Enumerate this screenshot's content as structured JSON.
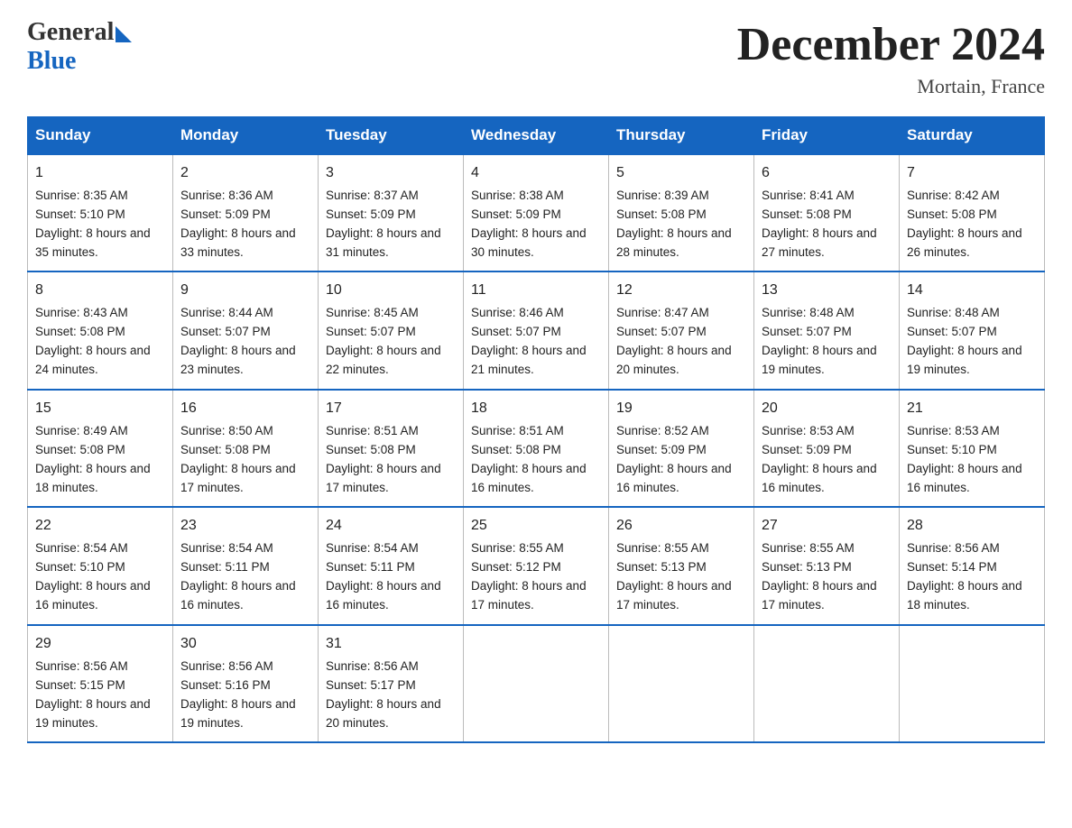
{
  "header": {
    "logo_general": "General",
    "logo_blue": "Blue",
    "title": "December 2024",
    "location": "Mortain, France"
  },
  "columns": [
    "Sunday",
    "Monday",
    "Tuesday",
    "Wednesday",
    "Thursday",
    "Friday",
    "Saturday"
  ],
  "weeks": [
    [
      {
        "day": "1",
        "sunrise": "8:35 AM",
        "sunset": "5:10 PM",
        "daylight": "8 hours and 35 minutes."
      },
      {
        "day": "2",
        "sunrise": "8:36 AM",
        "sunset": "5:09 PM",
        "daylight": "8 hours and 33 minutes."
      },
      {
        "day": "3",
        "sunrise": "8:37 AM",
        "sunset": "5:09 PM",
        "daylight": "8 hours and 31 minutes."
      },
      {
        "day": "4",
        "sunrise": "8:38 AM",
        "sunset": "5:09 PM",
        "daylight": "8 hours and 30 minutes."
      },
      {
        "day": "5",
        "sunrise": "8:39 AM",
        "sunset": "5:08 PM",
        "daylight": "8 hours and 28 minutes."
      },
      {
        "day": "6",
        "sunrise": "8:41 AM",
        "sunset": "5:08 PM",
        "daylight": "8 hours and 27 minutes."
      },
      {
        "day": "7",
        "sunrise": "8:42 AM",
        "sunset": "5:08 PM",
        "daylight": "8 hours and 26 minutes."
      }
    ],
    [
      {
        "day": "8",
        "sunrise": "8:43 AM",
        "sunset": "5:08 PM",
        "daylight": "8 hours and 24 minutes."
      },
      {
        "day": "9",
        "sunrise": "8:44 AM",
        "sunset": "5:07 PM",
        "daylight": "8 hours and 23 minutes."
      },
      {
        "day": "10",
        "sunrise": "8:45 AM",
        "sunset": "5:07 PM",
        "daylight": "8 hours and 22 minutes."
      },
      {
        "day": "11",
        "sunrise": "8:46 AM",
        "sunset": "5:07 PM",
        "daylight": "8 hours and 21 minutes."
      },
      {
        "day": "12",
        "sunrise": "8:47 AM",
        "sunset": "5:07 PM",
        "daylight": "8 hours and 20 minutes."
      },
      {
        "day": "13",
        "sunrise": "8:48 AM",
        "sunset": "5:07 PM",
        "daylight": "8 hours and 19 minutes."
      },
      {
        "day": "14",
        "sunrise": "8:48 AM",
        "sunset": "5:07 PM",
        "daylight": "8 hours and 19 minutes."
      }
    ],
    [
      {
        "day": "15",
        "sunrise": "8:49 AM",
        "sunset": "5:08 PM",
        "daylight": "8 hours and 18 minutes."
      },
      {
        "day": "16",
        "sunrise": "8:50 AM",
        "sunset": "5:08 PM",
        "daylight": "8 hours and 17 minutes."
      },
      {
        "day": "17",
        "sunrise": "8:51 AM",
        "sunset": "5:08 PM",
        "daylight": "8 hours and 17 minutes."
      },
      {
        "day": "18",
        "sunrise": "8:51 AM",
        "sunset": "5:08 PM",
        "daylight": "8 hours and 16 minutes."
      },
      {
        "day": "19",
        "sunrise": "8:52 AM",
        "sunset": "5:09 PM",
        "daylight": "8 hours and 16 minutes."
      },
      {
        "day": "20",
        "sunrise": "8:53 AM",
        "sunset": "5:09 PM",
        "daylight": "8 hours and 16 minutes."
      },
      {
        "day": "21",
        "sunrise": "8:53 AM",
        "sunset": "5:10 PM",
        "daylight": "8 hours and 16 minutes."
      }
    ],
    [
      {
        "day": "22",
        "sunrise": "8:54 AM",
        "sunset": "5:10 PM",
        "daylight": "8 hours and 16 minutes."
      },
      {
        "day": "23",
        "sunrise": "8:54 AM",
        "sunset": "5:11 PM",
        "daylight": "8 hours and 16 minutes."
      },
      {
        "day": "24",
        "sunrise": "8:54 AM",
        "sunset": "5:11 PM",
        "daylight": "8 hours and 16 minutes."
      },
      {
        "day": "25",
        "sunrise": "8:55 AM",
        "sunset": "5:12 PM",
        "daylight": "8 hours and 17 minutes."
      },
      {
        "day": "26",
        "sunrise": "8:55 AM",
        "sunset": "5:13 PM",
        "daylight": "8 hours and 17 minutes."
      },
      {
        "day": "27",
        "sunrise": "8:55 AM",
        "sunset": "5:13 PM",
        "daylight": "8 hours and 17 minutes."
      },
      {
        "day": "28",
        "sunrise": "8:56 AM",
        "sunset": "5:14 PM",
        "daylight": "8 hours and 18 minutes."
      }
    ],
    [
      {
        "day": "29",
        "sunrise": "8:56 AM",
        "sunset": "5:15 PM",
        "daylight": "8 hours and 19 minutes."
      },
      {
        "day": "30",
        "sunrise": "8:56 AM",
        "sunset": "5:16 PM",
        "daylight": "8 hours and 19 minutes."
      },
      {
        "day": "31",
        "sunrise": "8:56 AM",
        "sunset": "5:17 PM",
        "daylight": "8 hours and 20 minutes."
      },
      null,
      null,
      null,
      null
    ]
  ]
}
